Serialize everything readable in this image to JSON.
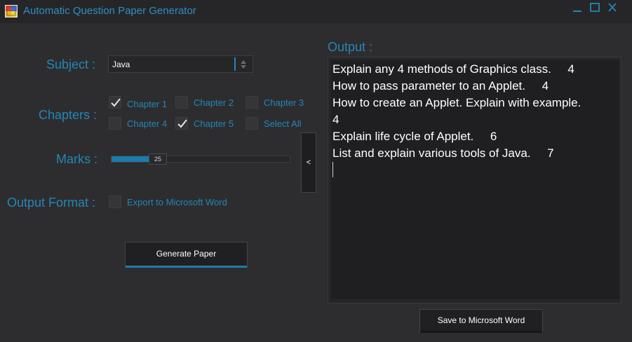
{
  "window": {
    "title": "Automatic Question Paper Generator"
  },
  "form": {
    "subject_label": "Subject :",
    "subject_value": "Java",
    "chapters_label": "Chapters :",
    "chapters": [
      {
        "label": "Chapter 1",
        "checked": true
      },
      {
        "label": "Chapter 2",
        "checked": false
      },
      {
        "label": "Chapter 3",
        "checked": false
      },
      {
        "label": "Chapter 4",
        "checked": false
      },
      {
        "label": "Chapter 5",
        "checked": true
      },
      {
        "label": "Select All",
        "checked": false
      }
    ],
    "marks_label": "Marks :",
    "marks_value": "25",
    "marks_fraction": 0.22,
    "collapse_label": "<",
    "output_format_label": "Output Format :",
    "export_label": "Export to Microsoft Word",
    "export_checked": false,
    "generate_label": "Generate Paper"
  },
  "output": {
    "label": "Output :",
    "lines": [
      "Explain any 4 methods of Graphics class.     4",
      "How to pass parameter to an Applet.     4",
      "How to create an Applet. Explain with example.",
      "4",
      "Explain life cycle of Applet.     6",
      "List and explain various tools of Java.     7"
    ],
    "save_label": "Save to Microsoft Word"
  },
  "colors": {
    "accent": "#2486b3",
    "background": "#2d2d30",
    "titlebar": "#262629"
  }
}
